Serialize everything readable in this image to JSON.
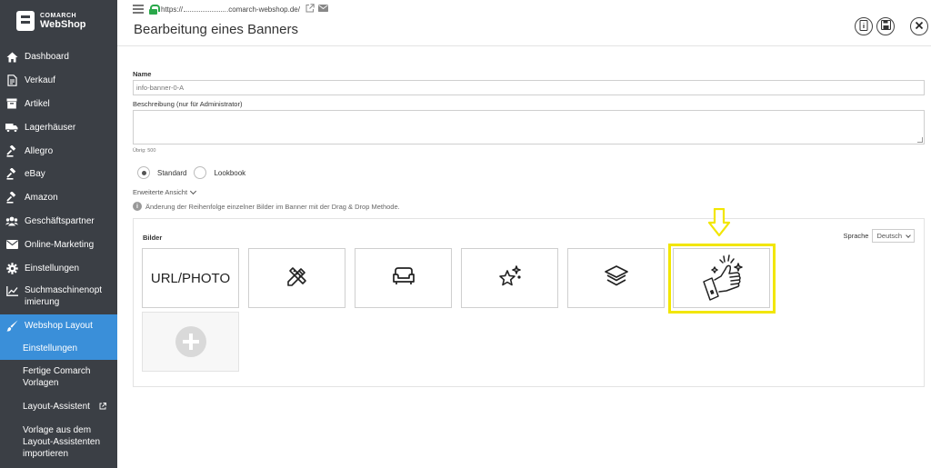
{
  "brand": {
    "small": "COMARCH",
    "big": "WebShop"
  },
  "sidebar": {
    "items": [
      {
        "label": "Dashboard",
        "icon": "home-icon"
      },
      {
        "label": "Verkauf",
        "icon": "document-icon"
      },
      {
        "label": "Artikel",
        "icon": "box-icon"
      },
      {
        "label": "Lagerhäuser",
        "icon": "truck-icon"
      },
      {
        "label": "Allegro",
        "icon": "gavel-icon"
      },
      {
        "label": "eBay",
        "icon": "gavel-icon"
      },
      {
        "label": "Amazon",
        "icon": "gavel-icon"
      },
      {
        "label": "Geschäftspartner",
        "icon": "users-icon"
      },
      {
        "label": "Online-Marketing",
        "icon": "envelope-icon"
      },
      {
        "label": "Einstellungen",
        "icon": "gear-icon"
      },
      {
        "label": "Suchmaschinenopt imierung",
        "icon": "chart-icon"
      },
      {
        "label": "Webshop Layout",
        "icon": "brush-icon"
      }
    ],
    "sub_items": [
      {
        "label": "Einstellungen"
      },
      {
        "label": "Fertige Comarch Vorlagen"
      },
      {
        "label": "Layout-Assistent"
      },
      {
        "label": "Vorlage aus dem Layout-Assistenten importieren"
      }
    ],
    "active_color": "#3a8fd9",
    "bg_color": "#3b3f45"
  },
  "topbar": {
    "url_prefix": "https://",
    "url_suffix": ".comarch-webshop.de/"
  },
  "page": {
    "title": "Bearbeitung eines Banners"
  },
  "form": {
    "name_label": "Name",
    "name_value": "info-banner-0-A",
    "desc_label": "Beschreibung (nur für Administrator)",
    "desc_hint": "Übrig: 500",
    "radio_standard": "Standard",
    "radio_lookbook": "Lookbook",
    "advanced": "Erweiterte Ansicht",
    "info": "Änderung der Reihenfolge einzelner Bilder im Banner mit der Drag & Drop Methode."
  },
  "images": {
    "label": "Bilder",
    "lang_label": "Sprache",
    "lang_value": "Deutsch",
    "tiles": [
      {
        "text": "URL/PHOTO",
        "icon": ""
      },
      {
        "text": "",
        "icon": "pencil-ruler-icon"
      },
      {
        "text": "",
        "icon": "sofa-icon"
      },
      {
        "text": "",
        "icon": "sparkle-star-icon"
      },
      {
        "text": "",
        "icon": "layers-icon"
      },
      {
        "text": "",
        "icon": "thumbs-up-hand-icon"
      }
    ],
    "highlight_color": "#f2e600"
  }
}
